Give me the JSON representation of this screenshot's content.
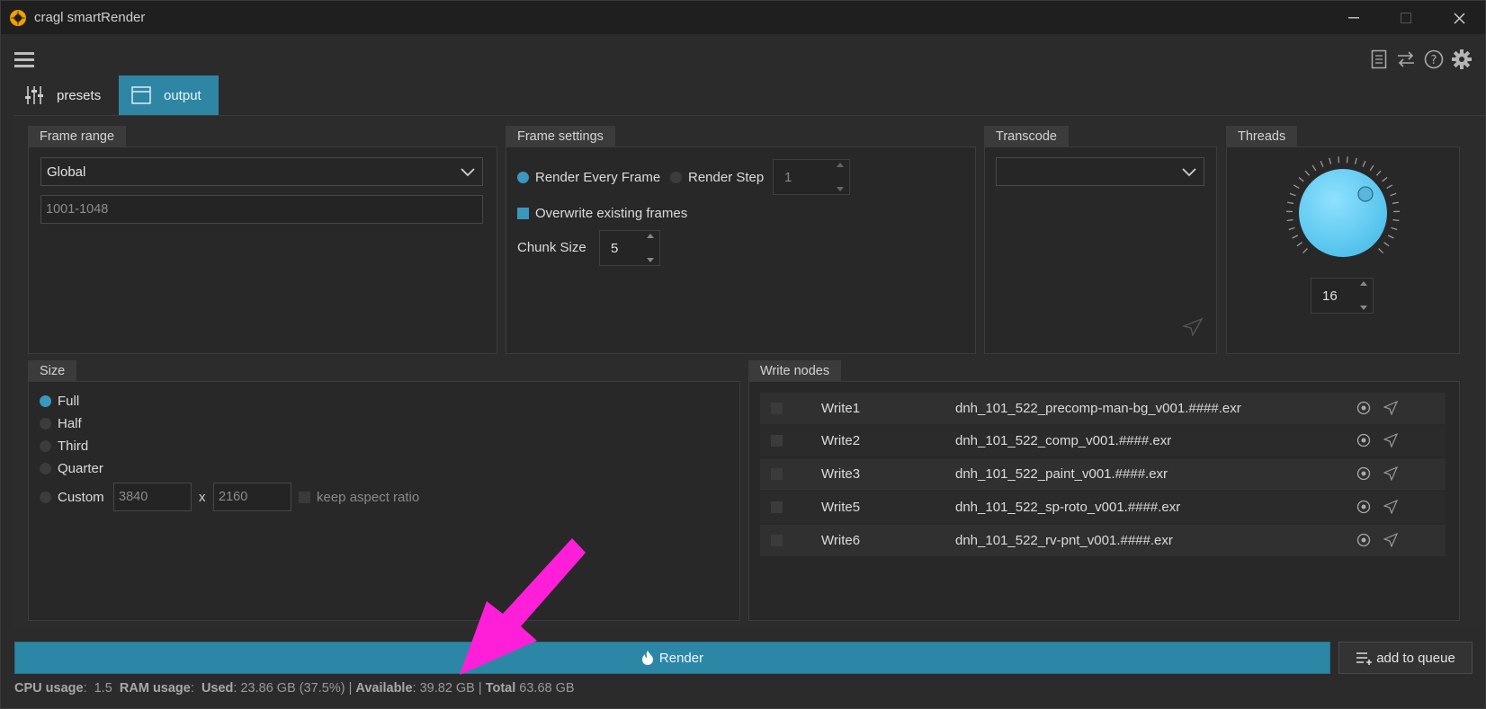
{
  "window": {
    "title": "cragl smartRender"
  },
  "tabs": [
    {
      "label": "presets"
    },
    {
      "label": "output"
    }
  ],
  "frame_range": {
    "title": "Frame range",
    "mode": "Global",
    "range_value": "1001-1048"
  },
  "frame_settings": {
    "title": "Frame settings",
    "render_every_frame": "Render Every Frame",
    "render_step": "Render Step",
    "step_value": "1",
    "overwrite": "Overwrite existing frames",
    "chunk_label": "Chunk Size",
    "chunk_value": "5"
  },
  "transcode": {
    "title": "Transcode",
    "selected": ""
  },
  "threads": {
    "title": "Threads",
    "value": "16"
  },
  "size": {
    "title": "Size",
    "options": [
      "Full",
      "Half",
      "Third",
      "Quarter",
      "Custom"
    ],
    "selected": "Full",
    "width": "3840",
    "x_label": "x",
    "height": "2160",
    "keep_aspect": "keep aspect ratio"
  },
  "write_nodes": {
    "title": "Write nodes",
    "rows": [
      {
        "name": "Write1",
        "file": "dnh_101_522_precomp-man-bg_v001.####.exr"
      },
      {
        "name": "Write2",
        "file": "dnh_101_522_comp_v001.####.exr"
      },
      {
        "name": "Write3",
        "file": "dnh_101_522_paint_v001.####.exr"
      },
      {
        "name": "Write5",
        "file": "dnh_101_522_sp-roto_v001.####.exr"
      },
      {
        "name": "Write6",
        "file": "dnh_101_522_rv-pnt_v001.####.exr"
      }
    ]
  },
  "actions": {
    "render": "Render",
    "add_to_queue": "add to queue"
  },
  "status": {
    "cpu_label": "CPU usage",
    "cpu_value": "1.5",
    "ram_label": "RAM usage",
    "used_label": "Used",
    "used_value": "23.86 GB (37.5%)",
    "available_label": "Available",
    "available_value": "39.82 GB",
    "total_label": "Total",
    "total_value": "63.68 GB"
  },
  "colors": {
    "accent": "#2f86a4",
    "annotation_arrow": "#ff1fd8"
  }
}
